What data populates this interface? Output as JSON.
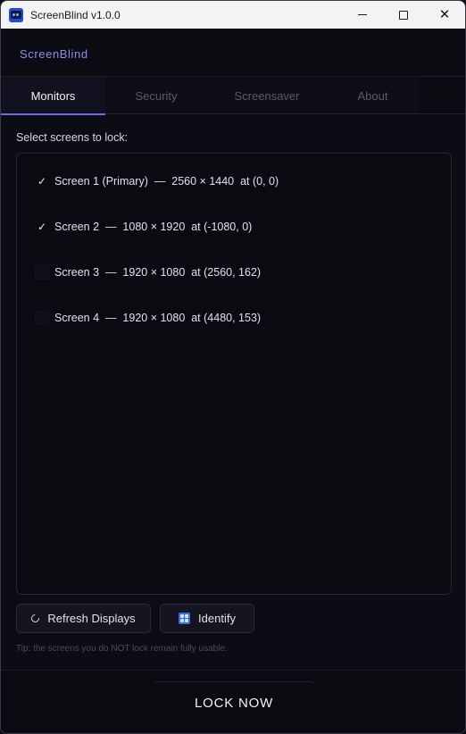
{
  "window": {
    "title": "ScreenBlind v1.0.0",
    "controls": {
      "minimize": "minimize",
      "maximize": "maximize",
      "close": "✕"
    }
  },
  "app": {
    "brand": "ScreenBlind"
  },
  "tabs": [
    {
      "label": "Monitors",
      "active": true
    },
    {
      "label": "Security",
      "active": false
    },
    {
      "label": "Screensaver",
      "active": false
    },
    {
      "label": "About",
      "active": false
    }
  ],
  "monitors": {
    "section_label": "Select screens to lock:",
    "screens": [
      {
        "label": "Screen 1 (Primary)  —  2560 × 1440  at (0, 0)",
        "checked": true
      },
      {
        "label": "Screen 2  —  1080 × 1920  at (-1080, 0)",
        "checked": true
      },
      {
        "label": "Screen 3  —  1920 × 1080  at (2560, 162)",
        "checked": false
      },
      {
        "label": "Screen 4  —  1920 × 1080  at (4480, 153)",
        "checked": false
      }
    ],
    "refresh_label": "Refresh Displays",
    "identify_label": "Identify",
    "tip": "Tip: the screens you do NOT lock remain fully usable."
  },
  "footer": {
    "lock_label": "LOCK NOW"
  },
  "colors": {
    "accent": "#6a6de8",
    "brand": "#8e8ff0",
    "background": "#0c0c14"
  },
  "icons": {
    "app": "app-icon",
    "check": "✓",
    "refresh": "refresh-icon",
    "identify": "identify-icon"
  }
}
